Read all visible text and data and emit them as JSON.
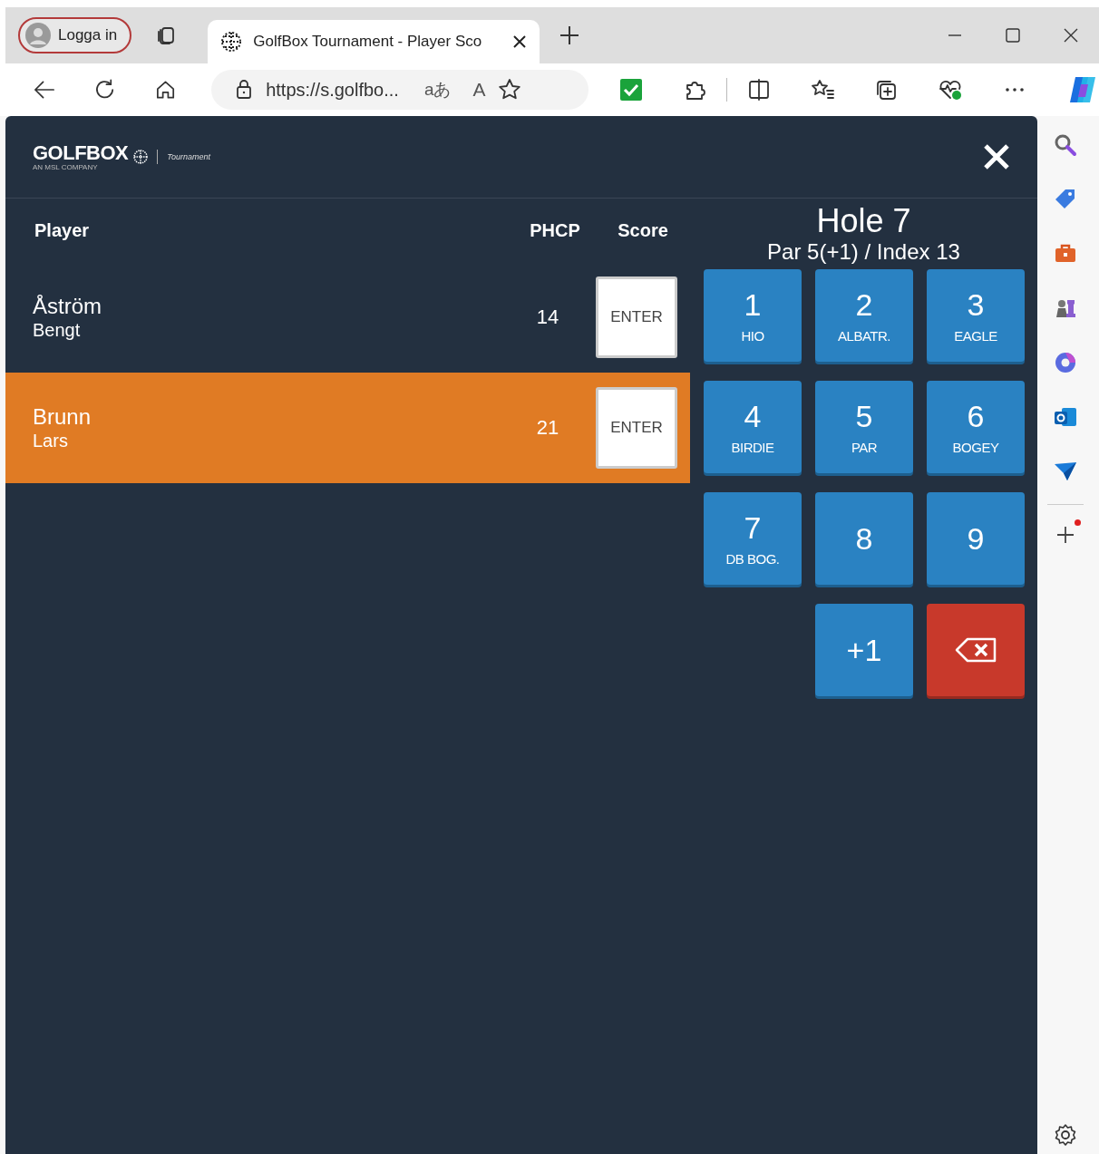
{
  "browser": {
    "profile_button": "Logga in",
    "tab": {
      "title": "GolfBox Tournament - Player Sco"
    },
    "address": {
      "url": "https://s.golfbo...",
      "translate_glyph": "aあ",
      "read_aloud_glyph": "A"
    }
  },
  "app": {
    "logo": {
      "wordmark": "GOLFBOX",
      "tagline": "AN MSL COMPANY",
      "product": "Tournament"
    },
    "columns": [
      "Player",
      "PHCP",
      "Score"
    ],
    "players": [
      {
        "last_name": "Åström",
        "first_name": "Bengt",
        "phcp": "14",
        "score_button": "ENTER",
        "selected": false
      },
      {
        "last_name": "Brunn",
        "first_name": "Lars",
        "phcp": "21",
        "score_button": "ENTER",
        "selected": true
      }
    ],
    "hole": {
      "title": "Hole 7",
      "details": "Par 5(+1) / Index 13"
    },
    "keys": [
      {
        "kind": "digit",
        "label": "1",
        "sub": "HIO"
      },
      {
        "kind": "digit",
        "label": "2",
        "sub": "ALBATR."
      },
      {
        "kind": "digit",
        "label": "3",
        "sub": "EAGLE"
      },
      {
        "kind": "digit",
        "label": "4",
        "sub": "BIRDIE"
      },
      {
        "kind": "digit",
        "label": "5",
        "sub": "PAR"
      },
      {
        "kind": "digit",
        "label": "6",
        "sub": "BOGEY"
      },
      {
        "kind": "digit",
        "label": "7",
        "sub": "DB BOG."
      },
      {
        "kind": "digit",
        "label": "8"
      },
      {
        "kind": "digit",
        "label": "9"
      },
      {
        "kind": "spacer"
      },
      {
        "kind": "digit",
        "label": "+1"
      },
      {
        "kind": "delete"
      }
    ]
  }
}
